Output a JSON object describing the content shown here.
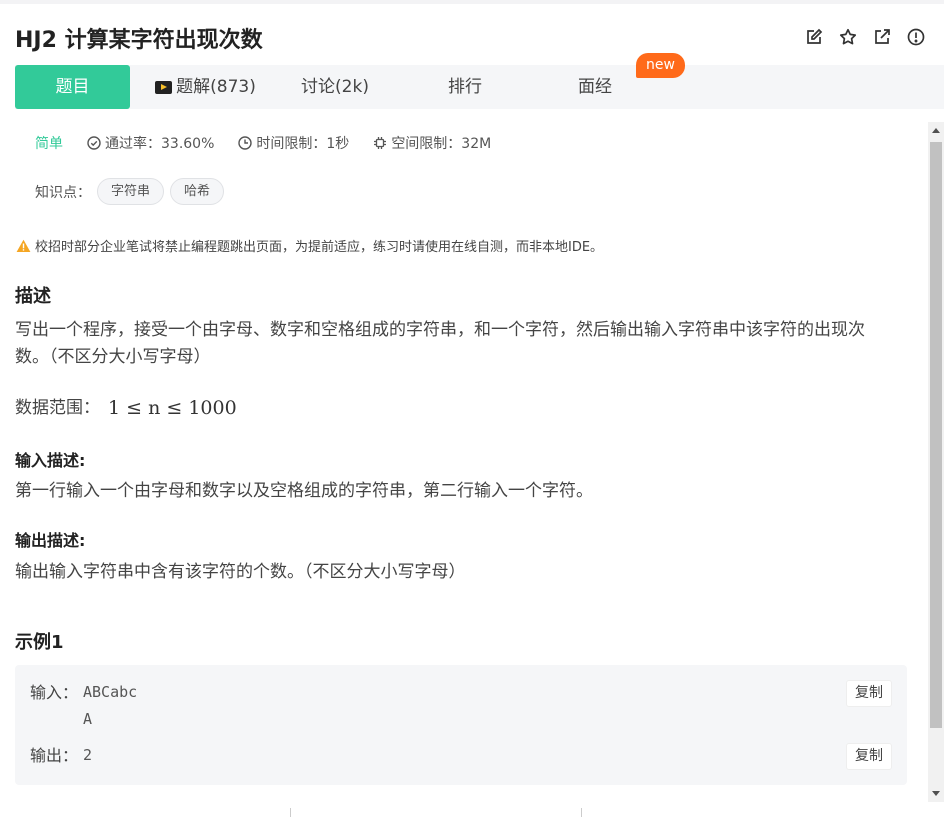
{
  "header": {
    "title": "HJ2  计算某字符出现次数",
    "icons": [
      "edit-icon",
      "star-icon",
      "external-link-icon",
      "info-icon"
    ]
  },
  "tabs": [
    {
      "label": "题目",
      "active": true
    },
    {
      "label": "题解(873)",
      "icon": "video-icon"
    },
    {
      "label": "讨论(2k)"
    },
    {
      "label": "排行"
    },
    {
      "label": "面经",
      "badge": "new"
    }
  ],
  "meta": {
    "difficulty": "简单",
    "pass_rate": "通过率：33.60%",
    "time_limit": "时间限制：1秒",
    "memory_limit": "空间限制：32M"
  },
  "knowledge": {
    "label": "知识点：",
    "tags": [
      "字符串",
      "哈希"
    ]
  },
  "warning": "校招时部分企业笔试将禁止编程题跳出页面，为提前适应，练习时请使用在线自测，而非本地IDE。",
  "description": {
    "heading": "描述",
    "line1": "写出一个程序，接受一个由字母、数字和空格组成的字符串，和一个字符，然后输出输入字符串中该字符的出现次",
    "line2": "数。（不区分大小写字母）",
    "range_label": "数据范围：",
    "range_formula": "1 ≤ n ≤ 1000"
  },
  "input_desc": {
    "heading": "输入描述:",
    "text": "第一行输入一个由字母和数字以及空格组成的字符串，第二行输入一个字符。"
  },
  "output_desc": {
    "heading": "输出描述:",
    "text": "输出输入字符串中含有该字符的个数。（不区分大小写字母）"
  },
  "example": {
    "heading": "示例1",
    "input_label": "输入：",
    "input_value": "ABCabc\nA",
    "output_label": "输出：",
    "output_value": "2",
    "copy_label": "复制"
  },
  "colors": {
    "accent": "#32ca99",
    "badge": "#ff6a1a",
    "warning": "#f5a623"
  }
}
